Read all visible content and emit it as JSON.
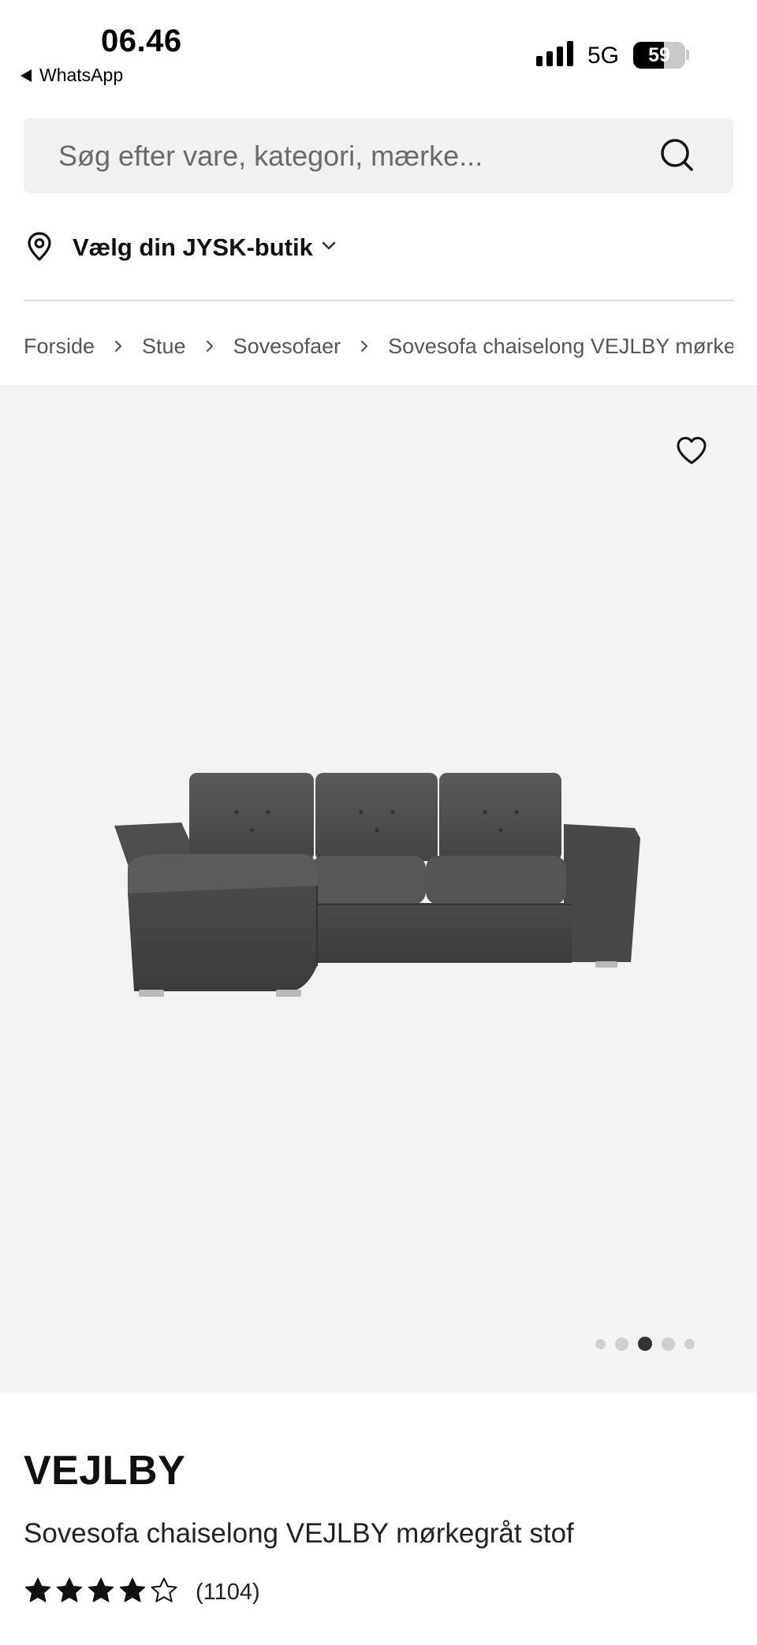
{
  "status_bar": {
    "time": "06.46",
    "back_app": "WhatsApp",
    "network": "5G",
    "battery": "59",
    "battery_level_percent": 59
  },
  "search": {
    "placeholder": "Søg efter vare, kategori, mærke...",
    "icon": "search-icon"
  },
  "store": {
    "label": "Vælg din JYSK-butik",
    "icon": "location-pin-icon"
  },
  "breadcrumb": {
    "items": [
      "Forside",
      "Stue",
      "Sovesofaer",
      "Sovesofa chaiselong VEJLBY mørkegråt stof"
    ]
  },
  "gallery": {
    "image_count": 5,
    "active_index": 3,
    "favorite_icon": "heart-icon"
  },
  "product": {
    "brand": "VEJLBY",
    "name": "Sovesofa chaiselong VEJLBY mørkegråt stof",
    "rating": 4,
    "rating_max": 5,
    "review_count": "(1104)"
  },
  "colors": {
    "sofa": "#4a4a4a",
    "gallery_bg": "#f3f3f3",
    "search_bg": "#f1f1f1"
  }
}
